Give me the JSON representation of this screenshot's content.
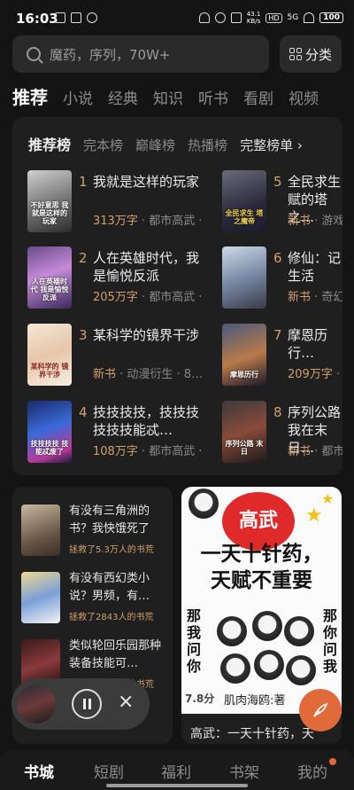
{
  "status_bar": {
    "time": "16:03",
    "speed_value": "43.1",
    "speed_unit": "KB/s",
    "hd": "HD",
    "signal": "5G",
    "battery": "100"
  },
  "search": {
    "placeholder": "魔药，序列，70W+"
  },
  "category_button": {
    "label": "分类"
  },
  "top_tabs": [
    "推荐",
    "小说",
    "经典",
    "知识",
    "听书",
    "看剧",
    "视频"
  ],
  "ranking": {
    "tabs": [
      "推荐榜",
      "完本榜",
      "巅峰榜",
      "热播榜"
    ],
    "full_list_label": "完整榜单",
    "full_list_arrow": "›",
    "books": [
      {
        "rank": "1",
        "title": "我就是这样的玩家",
        "words": "313万字",
        "meta": " · 都市高武 ·",
        "cover_text": "不好意思 我就是这样的玩家"
      },
      {
        "rank": "2",
        "title": "人在英雄时代，我是愉悦反派",
        "words": "205万字",
        "meta": " · 都市高武 ·",
        "cover_text": "人在英雄时代 我是愉悦反派"
      },
      {
        "rank": "3",
        "title": "某科学的镜界干涉",
        "words": "新书",
        "meta": " · 动漫衍生 · 8…",
        "cover_text": "某科学的 镜界干涉"
      },
      {
        "rank": "4",
        "title": "技技技技，技技技技技技能忒…",
        "words": "108万字",
        "meta": " · 都市高武 ·",
        "cover_text": "技技技技 技能忒废了"
      },
      {
        "rank": "5",
        "title": "全民求生赋的塔之…",
        "words": "新书",
        "meta": " · 游戏",
        "cover_text": "全民求生 塔之魔帝"
      },
      {
        "rank": "6",
        "title": "修仙：记生活",
        "words": "新书",
        "meta": " · 奇幻",
        "cover_text": ""
      },
      {
        "rank": "7",
        "title": "摩恩历行…",
        "words": "209万字",
        "meta": " ·",
        "cover_text": "摩恩历行"
      },
      {
        "rank": "8",
        "title": "序列公路我在末日…",
        "words": "新书",
        "meta": " · 都市",
        "cover_text": "序列公路 末日"
      }
    ]
  },
  "questions": [
    {
      "title": "有没有三角洲的书？我快饿死了",
      "saved": "拯救了5.3万人的书荒"
    },
    {
      "title": "有没有西幻类小说？男频，有…",
      "saved": "拯救了2843人的书荒"
    },
    {
      "title": "类似轮回乐园那种装备技能可…",
      "saved": "拯救了1.3万人的书荒"
    }
  ],
  "promo": {
    "badge": "高武",
    "title_line1": "一天十针药，",
    "title_line2": "天赋不重要",
    "side_left": "那我问你",
    "side_right": "那你问我",
    "number": "7.8分",
    "author": "肌肉海鸥:著",
    "caption": "高武：一天十针药，天"
  },
  "player": {
    "close": "×"
  },
  "fab": {
    "icon": "pen-icon"
  },
  "bottom_nav": [
    "书城",
    "短剧",
    "福利",
    "书架",
    "我的"
  ],
  "colors": {
    "accent": "#d2a06b",
    "background": "#141414",
    "card": "#1f1f1f",
    "fab": "#e06a3a"
  }
}
